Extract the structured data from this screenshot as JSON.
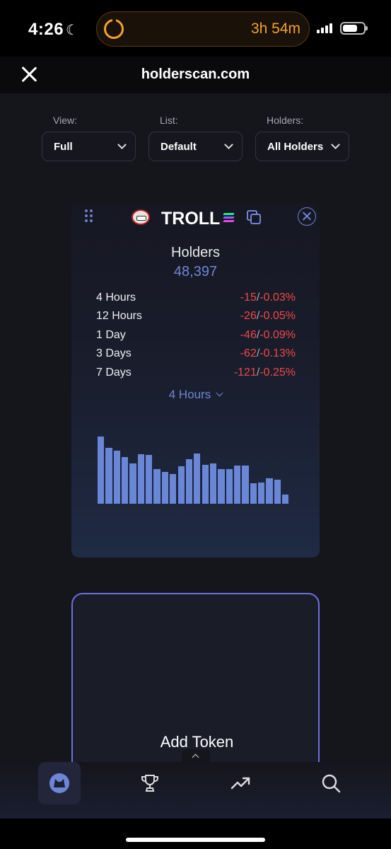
{
  "status_bar": {
    "time": "4:26",
    "timer": "3h 54m"
  },
  "browser": {
    "domain": "holderscan.com"
  },
  "filters": [
    {
      "label": "View:",
      "value": "Full"
    },
    {
      "label": "List:",
      "value": "Default"
    },
    {
      "label": "Holders:",
      "value": "All Holders"
    }
  ],
  "token_card": {
    "symbol": "TROLL",
    "holders_label": "Holders",
    "holders_count": "48,397",
    "changes": [
      {
        "period": "4 Hours",
        "abs": "-15",
        "pct": "-0.03%"
      },
      {
        "period": "12 Hours",
        "abs": "-26",
        "pct": "-0.05%"
      },
      {
        "period": "1 Day",
        "abs": "-46",
        "pct": "-0.09%"
      },
      {
        "period": "3 Days",
        "abs": "-62",
        "pct": "-0.13%"
      },
      {
        "period": "7 Days",
        "abs": "-121",
        "pct": "-0.25%"
      }
    ],
    "chart_period": "4 Hours",
    "bar_color": "#6a86d6",
    "bar_levels": [
      1.0,
      0.83,
      0.79,
      0.69,
      0.6,
      0.74,
      0.73,
      0.52,
      0.47,
      0.44,
      0.56,
      0.66,
      0.75,
      0.58,
      0.6,
      0.52,
      0.52,
      0.57,
      0.57,
      0.31,
      0.32,
      0.38,
      0.36,
      0.14
    ]
  },
  "add_token": {
    "label": "Add Token"
  },
  "nav": {
    "items": [
      {
        "icon": "cat-logo-icon",
        "active": true
      },
      {
        "icon": "trophy-icon",
        "active": false
      },
      {
        "icon": "trending-up-icon",
        "active": false
      },
      {
        "icon": "search-icon",
        "active": false
      }
    ]
  },
  "colors": {
    "accent": "#6f86d6",
    "negative": "#f04848",
    "timer": "#f4a12a",
    "add_border": "#6f6fe0"
  }
}
